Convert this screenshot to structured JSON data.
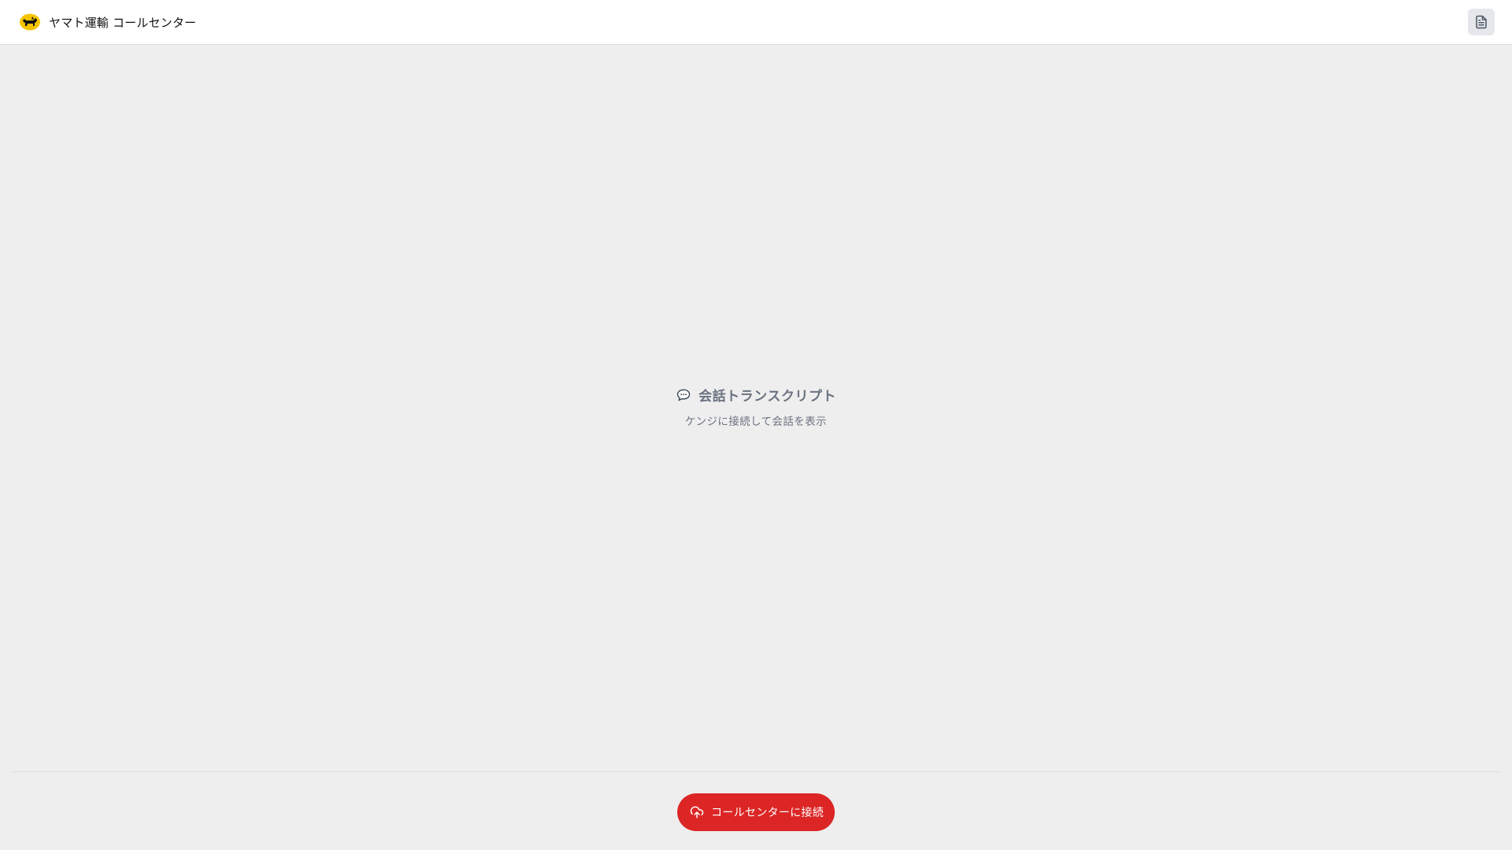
{
  "header": {
    "title": "ヤマト運輸 コールセンター",
    "logo_icon": "black-cat-logo-icon",
    "logo_color": "#f5c400",
    "document_icon": "document-icon"
  },
  "main": {
    "empty_state": {
      "icon": "speech-bubble-icon",
      "title": "会話トランスクリプト",
      "subtitle": "ケンジに接続して会話を表示"
    }
  },
  "footer": {
    "connect_button": {
      "label": "コールセンターに接続",
      "icon": "cloud-upload-icon",
      "color": "#dc2626"
    }
  }
}
